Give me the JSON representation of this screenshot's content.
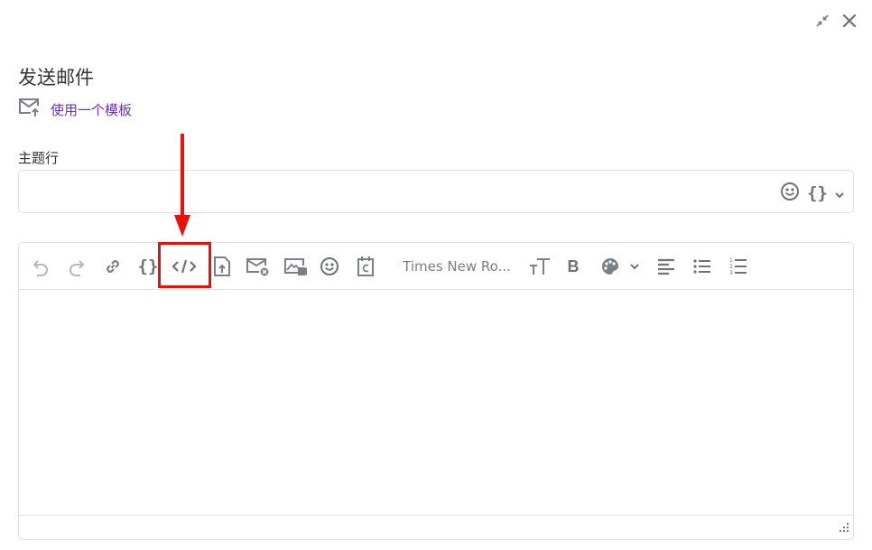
{
  "window": {
    "minimize_icon": "collapse-icon",
    "close_icon": "close-icon"
  },
  "dialog": {
    "title": "发送邮件",
    "template_link": "使用一个模板",
    "subject_label": "主题行",
    "subject_value": ""
  },
  "toolbar": {
    "font_name": "Times New Ro...",
    "items": [
      "undo",
      "redo",
      "link",
      "variable",
      "source-code",
      "attachment",
      "email-remove",
      "image-video",
      "emoji",
      "clipboard",
      "font-family",
      "font-size",
      "bold",
      "text-color",
      "align-left",
      "bullet-list",
      "numbered-list"
    ]
  },
  "colors": {
    "accent": "#6b2fc7",
    "icon": "#7b8088",
    "disabled_icon": "#b5b9bf",
    "highlight": "#e8120c"
  }
}
